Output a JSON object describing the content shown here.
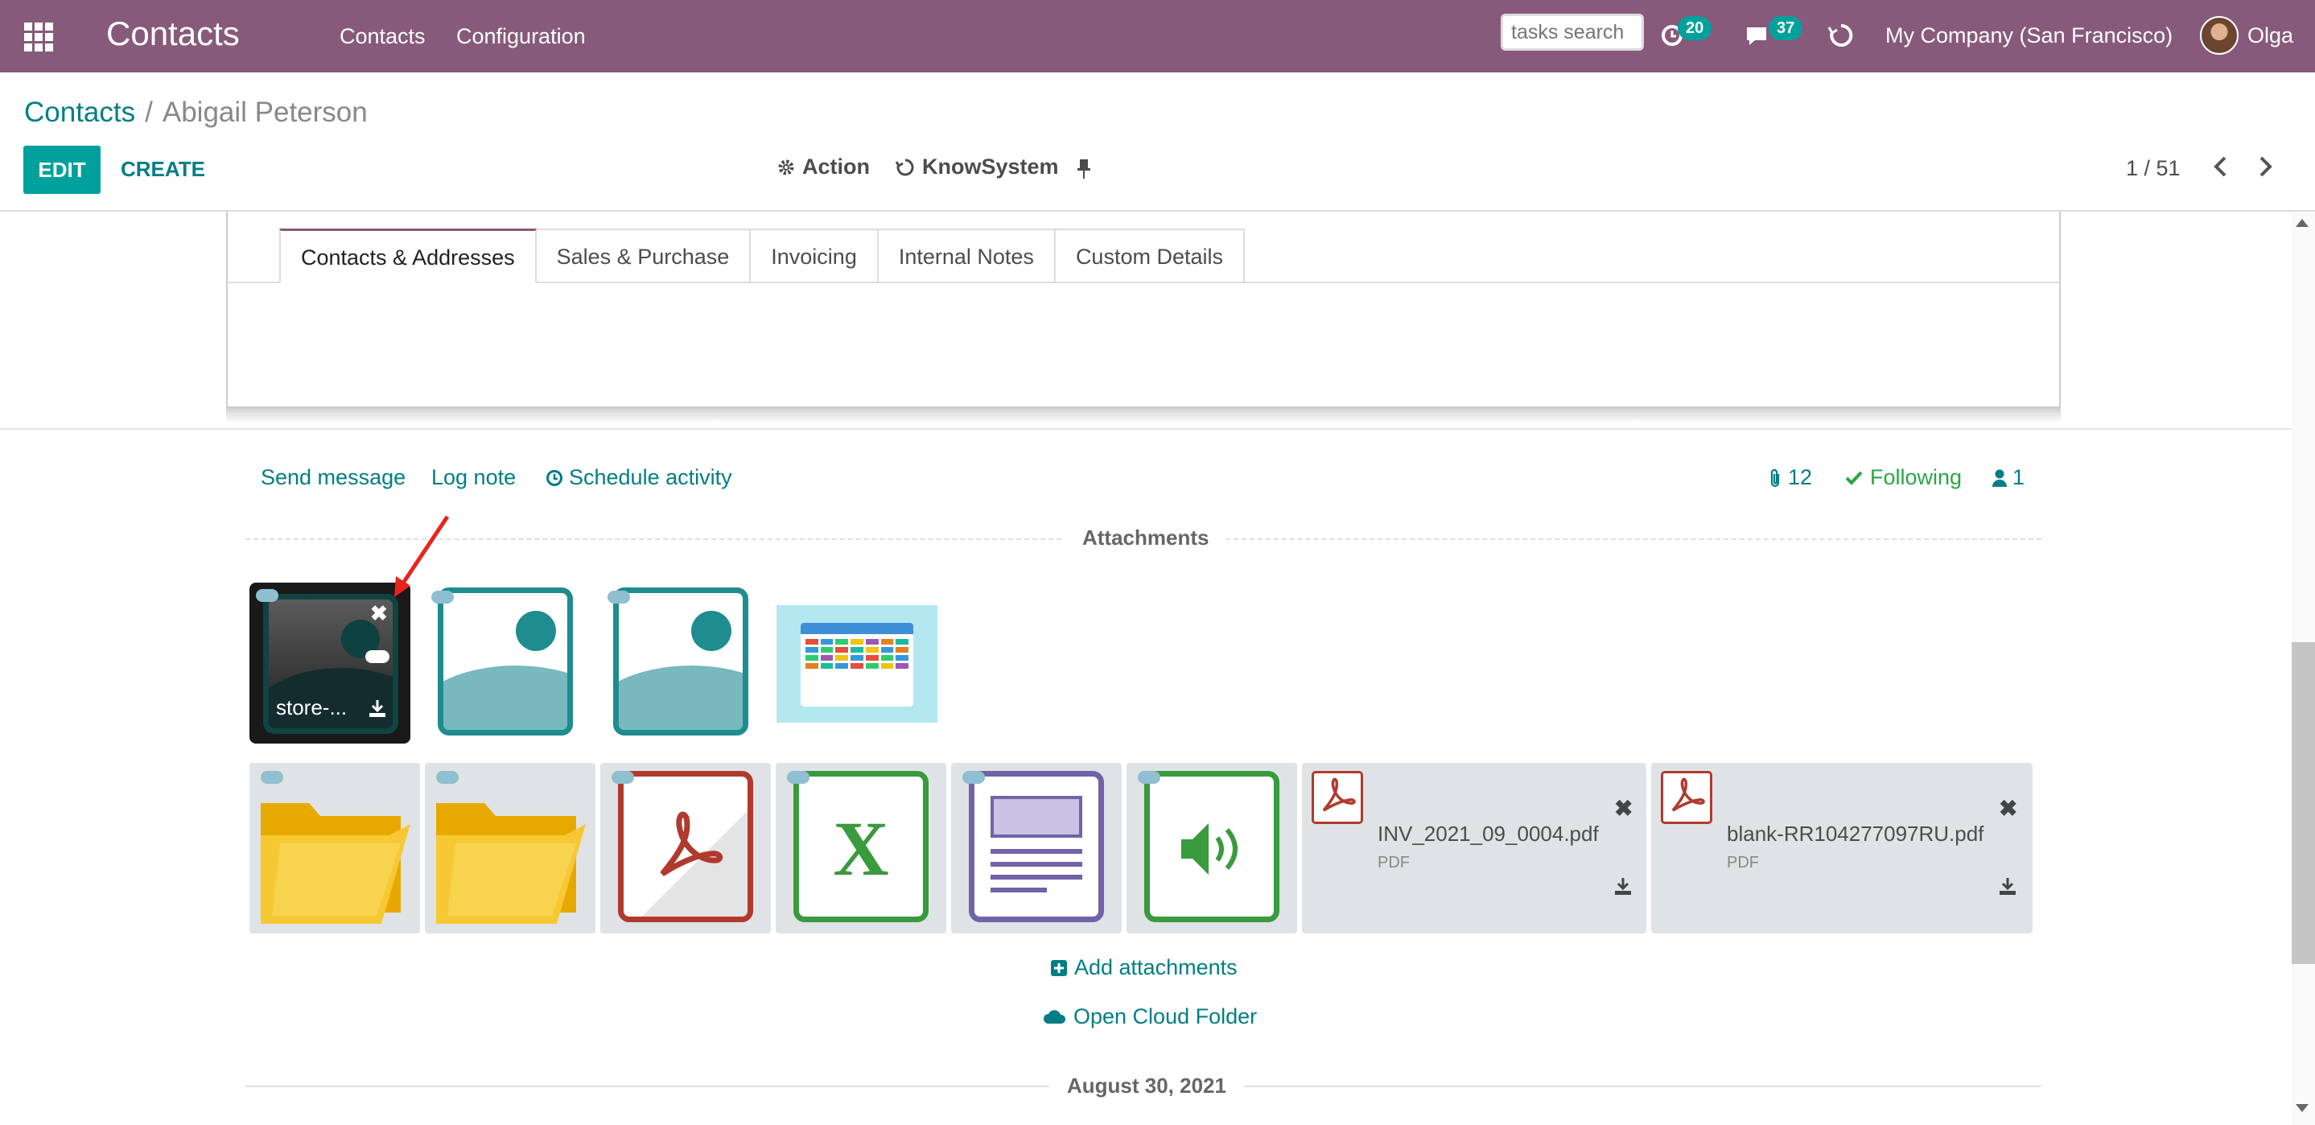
{
  "topbar": {
    "app_title": "Contacts",
    "menu": [
      "Contacts",
      "Configuration"
    ],
    "search_placeholder": "tasks search",
    "activity_count": "20",
    "messages_count": "37",
    "company": "My Company (San Francisco)",
    "user": "Olga"
  },
  "breadcrumb": {
    "parent": "Contacts",
    "separator": "/",
    "current": "Abigail Peterson"
  },
  "controls": {
    "edit": "EDIT",
    "create": "CREATE",
    "action": "Action",
    "knowsystem": "KnowSystem",
    "pager": "1 / 51"
  },
  "tabs": [
    "Contacts & Addresses",
    "Sales & Purchase",
    "Invoicing",
    "Internal Notes",
    "Custom Details"
  ],
  "chatter": {
    "send_message": "Send message",
    "log_note": "Log note",
    "schedule_activity": "Schedule activity",
    "attachments_count": "12",
    "following": "Following",
    "followers_count": "1"
  },
  "attachments": {
    "section_title": "Attachments",
    "first_image_name": "store-...",
    "files": [
      {
        "name": "INV_2021_09_0004.pdf",
        "type": "PDF"
      },
      {
        "name": "blank-RR104277097RU.pdf",
        "type": "PDF"
      }
    ],
    "add_attachments": "Add attachments",
    "open_cloud_folder": "Open Cloud Folder"
  },
  "timeline": {
    "date_separator": "August 30, 2021"
  },
  "colors": {
    "brand": "#875a7b",
    "accent": "#00a09d",
    "link": "#017e84",
    "following": "#28a745",
    "arrow": "#e8231f"
  }
}
